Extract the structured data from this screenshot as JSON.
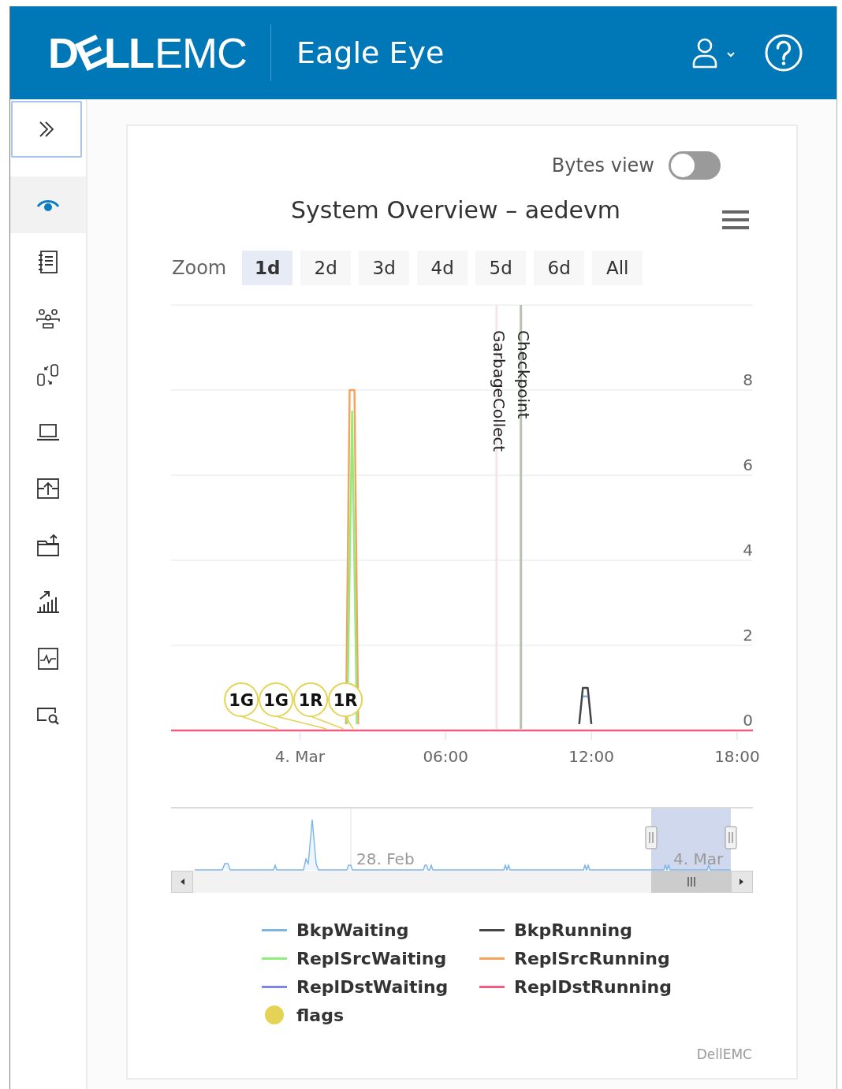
{
  "header": {
    "logo_bold": "DELL",
    "logo_light": "EMC",
    "app_title": "Eagle Eye"
  },
  "sidebar": {
    "items": [
      {
        "selected": true
      },
      {
        "selected": false
      },
      {
        "selected": false
      },
      {
        "selected": false
      },
      {
        "selected": false
      },
      {
        "selected": false
      },
      {
        "selected": false
      },
      {
        "selected": false
      },
      {
        "selected": false
      },
      {
        "selected": false
      }
    ]
  },
  "bytes_view": {
    "label": "Bytes view",
    "on": false
  },
  "title": "System Overview – aedevm",
  "zoom": {
    "label": "Zoom",
    "buttons": [
      {
        "label": "1d",
        "selected": true
      },
      {
        "label": "2d",
        "selected": false
      },
      {
        "label": "3d",
        "selected": false
      },
      {
        "label": "4d",
        "selected": false
      },
      {
        "label": "5d",
        "selected": false
      },
      {
        "label": "6d",
        "selected": false
      },
      {
        "label": "All",
        "selected": false
      }
    ]
  },
  "chart_data": {
    "type": "line",
    "x": [
      -5.3,
      1.9,
      1.95,
      2.05,
      2.15,
      2.25,
      2.35,
      2.4,
      11.5,
      11.65,
      11.85,
      12.0,
      18.65
    ],
    "series": [
      {
        "name": "BkpWaiting",
        "color": "#7cb5ec",
        "values": [
          null,
          null,
          null,
          null,
          null,
          null,
          null,
          null,
          null,
          0.8,
          0.8,
          null,
          null
        ]
      },
      {
        "name": "BkpRunning",
        "color": "#434348",
        "values": [
          null,
          null,
          null,
          null,
          null,
          null,
          null,
          null,
          0.15,
          1,
          1,
          0.15,
          null
        ]
      },
      {
        "name": "ReplSrcWaiting",
        "color": "#90ed7d",
        "values": [
          null,
          null,
          0.15,
          3.8,
          7.5,
          3.8,
          0.15,
          null,
          null,
          null,
          null,
          null,
          null
        ]
      },
      {
        "name": "ReplSrcRunning",
        "color": "#f7a35c",
        "values": [
          null,
          0.15,
          2.8,
          8,
          8,
          8,
          2.8,
          0.15,
          null,
          null,
          null,
          null,
          null
        ]
      },
      {
        "name": "ReplDstWaiting",
        "color": "#8085e9",
        "values": [
          null,
          null,
          null,
          null,
          null,
          null,
          null,
          null,
          null,
          null,
          null,
          null,
          null
        ]
      },
      {
        "name": "ReplDstRunning",
        "color": "#f15c80",
        "values": [
          0,
          0,
          0,
          0,
          0,
          0,
          0,
          0,
          0,
          0,
          0,
          0,
          0
        ]
      }
    ],
    "xlim": [
      -5.3,
      18.65
    ],
    "ylim": [
      0,
      10
    ],
    "xticks": [
      {
        "value": 0,
        "label": "4. Mar"
      },
      {
        "value": 6,
        "label": "06:00"
      },
      {
        "value": 12,
        "label": "12:00"
      },
      {
        "value": 18,
        "label": "18:00"
      }
    ],
    "yticks": [
      0,
      2,
      4,
      6,
      8
    ],
    "grid": true,
    "ref_lines": [
      {
        "axis": "x",
        "value": 8.1,
        "label": "GarbageCollect",
        "color": "#f3e6ea"
      },
      {
        "axis": "x",
        "value": 9.1,
        "label": "Checkpoint",
        "color": "#b4c2b0"
      }
    ],
    "annotations": [
      {
        "x": -0.9,
        "y": 0,
        "text": "1G"
      },
      {
        "x": 1.1,
        "y": 0,
        "text": "1G"
      },
      {
        "x": 1.8,
        "y": 0,
        "text": "1R"
      },
      {
        "x": 2.2,
        "y": 0,
        "text": "1R"
      }
    ]
  },
  "navigator": {
    "labels": [
      "28. Feb",
      "4. Mar"
    ]
  },
  "flags_legend": {
    "label": "flags",
    "color": "#e4d354"
  },
  "credit": "DellEMC"
}
